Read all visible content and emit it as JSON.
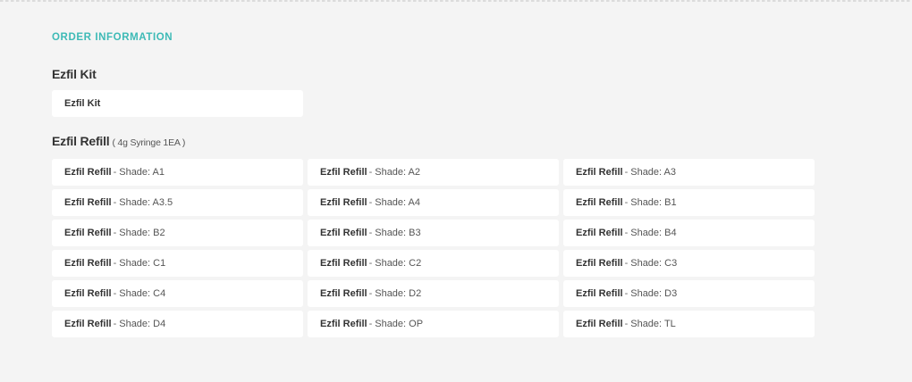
{
  "section_heading": "ORDER INFORMATION",
  "kit": {
    "title": "Ezfil Kit",
    "options": [
      {
        "name": "Ezfil Kit"
      }
    ]
  },
  "refill": {
    "title": "Ezfil Refill",
    "note": "( 4g Syringe 1EA )",
    "options": [
      {
        "name": "Ezfil Refill",
        "sep": "-",
        "shade": "Shade: A1"
      },
      {
        "name": "Ezfil Refill",
        "sep": "-",
        "shade": "Shade: A2"
      },
      {
        "name": "Ezfil Refill",
        "sep": "-",
        "shade": "Shade: A3"
      },
      {
        "name": "Ezfil Refill",
        "sep": "-",
        "shade": "Shade: A3.5"
      },
      {
        "name": "Ezfil Refill",
        "sep": "-",
        "shade": "Shade: A4"
      },
      {
        "name": "Ezfil Refill",
        "sep": "-",
        "shade": "Shade: B1"
      },
      {
        "name": "Ezfil Refill",
        "sep": "-",
        "shade": "Shade: B2"
      },
      {
        "name": "Ezfil Refill",
        "sep": "-",
        "shade": "Shade: B3"
      },
      {
        "name": "Ezfil Refill",
        "sep": "-",
        "shade": "Shade: B4"
      },
      {
        "name": "Ezfil Refill",
        "sep": "-",
        "shade": "Shade: C1"
      },
      {
        "name": "Ezfil Refill",
        "sep": "-",
        "shade": "Shade: C2"
      },
      {
        "name": "Ezfil Refill",
        "sep": "-",
        "shade": "Shade: C3"
      },
      {
        "name": "Ezfil Refill",
        "sep": "-",
        "shade": "Shade: C4"
      },
      {
        "name": "Ezfil Refill",
        "sep": "-",
        "shade": "Shade: D2"
      },
      {
        "name": "Ezfil Refill",
        "sep": "-",
        "shade": "Shade: D3"
      },
      {
        "name": "Ezfil Refill",
        "sep": "-",
        "shade": "Shade: D4"
      },
      {
        "name": "Ezfil Refill",
        "sep": "-",
        "shade": "Shade: OP"
      },
      {
        "name": "Ezfil Refill",
        "sep": "-",
        "shade": "Shade: TL"
      }
    ]
  },
  "colors": {
    "accent": "#3dbab6",
    "background": "#f4f4f4",
    "card": "#ffffff"
  }
}
